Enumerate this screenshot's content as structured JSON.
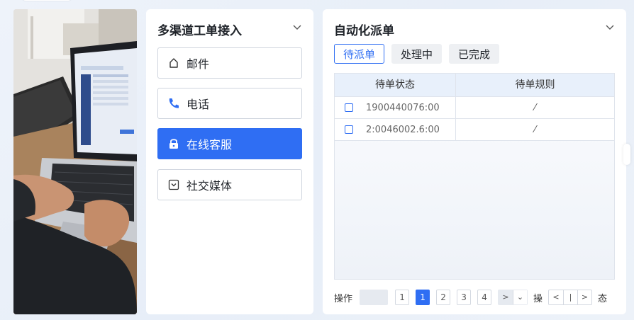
{
  "channels": {
    "title": "多渠道工单接入",
    "items": [
      {
        "label": "邮件",
        "icon": "mail-icon",
        "active": false
      },
      {
        "label": "电话",
        "icon": "phone-icon",
        "active": false
      },
      {
        "label": "在线客服",
        "icon": "lock-icon",
        "active": true
      },
      {
        "label": "社交媒体",
        "icon": "social-icon",
        "active": false
      }
    ]
  },
  "dispatch": {
    "title": "自动化派单",
    "tabs": [
      {
        "label": "待派单",
        "active": true
      },
      {
        "label": "处理中",
        "active": false
      },
      {
        "label": "已完成",
        "active": false
      }
    ],
    "table": {
      "headers": [
        "待单状态",
        "待单规则"
      ],
      "rows": [
        {
          "status": "1900440076:00",
          "rule": "⁄"
        },
        {
          "status": "2:0046002.6:00",
          "rule": "⁄"
        }
      ]
    },
    "pager": {
      "label": "操作",
      "pages": [
        "1",
        "1",
        "2",
        "3",
        "4"
      ],
      "next": ">",
      "dropdown": "⌄",
      "label2": "操",
      "nav": [
        "<",
        "|",
        ">"
      ],
      "label3": "态"
    }
  },
  "colors": {
    "accent": "#2f6ef3",
    "background": "#eef3fa"
  }
}
